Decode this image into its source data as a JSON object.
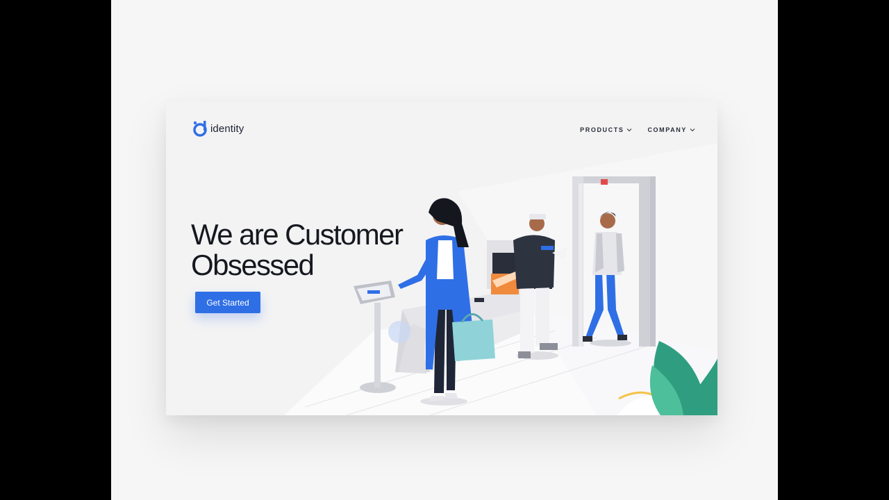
{
  "brand": {
    "name": "identity",
    "accent": "#2f6fe6"
  },
  "nav": {
    "items": [
      {
        "label": "PRODUCTS"
      },
      {
        "label": "COMPANY"
      }
    ]
  },
  "hero": {
    "title_line1": "We are Customer",
    "title_line2": "Obsessed",
    "cta_label": "Get Started"
  },
  "icons": {
    "logo": "identity-logo-icon",
    "dropdown": "chevron-down-icon"
  }
}
